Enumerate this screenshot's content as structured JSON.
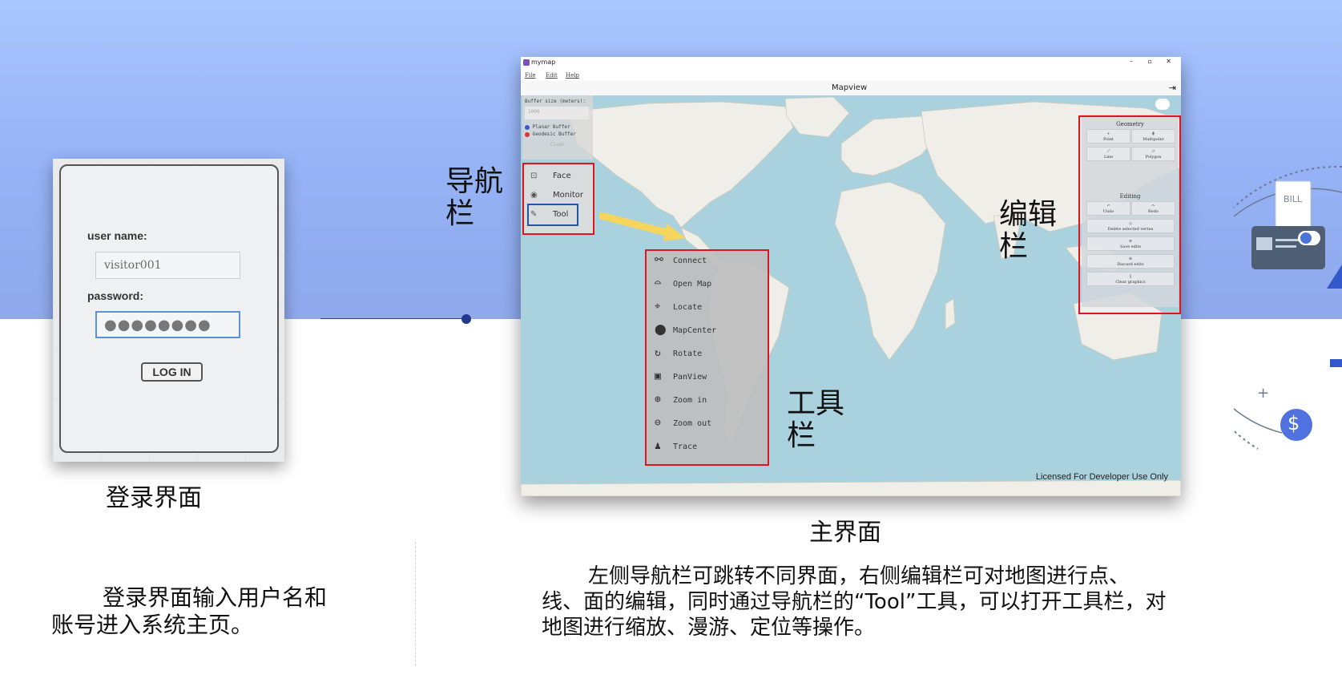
{
  "login": {
    "username_label": "user name:",
    "username_value": "visitor001",
    "password_label": "password:",
    "password_mask": "●●●●●●●●",
    "button_label": "LOG IN"
  },
  "captions": {
    "login_caption": "登录界面",
    "main_caption": "主界面",
    "nav_label": "导航栏",
    "edit_label": "编辑栏",
    "toolbar_label": "工具栏",
    "login_desc": "登录界面输入用户名和账号进入系统主页。",
    "main_desc": "左侧导航栏可跳转不同界面，右侧编辑栏可对地图进行点、线、面的编辑，同时通过导航栏的“Tool”工具，可以打开工具栏，对地图进行缩放、漫游、定位等操作。"
  },
  "app": {
    "window_title": "mymap",
    "menu": [
      "File",
      "Edit",
      "Help"
    ],
    "view_title": "Mapview",
    "license": "Licensed For Developer Use Only",
    "buffer": {
      "label": "Buffer size (meters):",
      "value": "1000",
      "planar": "Planar Buffer",
      "geodesic": "Geodesic Buffer",
      "clear": "Clear"
    },
    "nav_items": [
      "Face",
      "Monitor",
      "Tool"
    ],
    "tools": [
      "Connect",
      "Open Map",
      "Locate",
      "MapCenter",
      "Rotate",
      "PanView",
      "Zoom in",
      "Zoom out",
      "Trace"
    ],
    "edit_panel": {
      "geometry_title": "Geometry",
      "geometry_buttons": [
        "Point",
        "Multipoint",
        "Line",
        "Polygon"
      ],
      "editing_title": "Editing",
      "editing_buttons": [
        "Undo",
        "Redo"
      ],
      "actions": [
        "Delete selected vertex",
        "Save edits",
        "Discard edits",
        "Clear graphics"
      ]
    }
  },
  "deco": {
    "bill_text": "BILL",
    "dollar": "$",
    "plus": "+"
  },
  "colors": {
    "highlight_red": "#e0141e",
    "highlight_blue": "#2456a6",
    "arrow_yellow": "#f6d55c"
  }
}
